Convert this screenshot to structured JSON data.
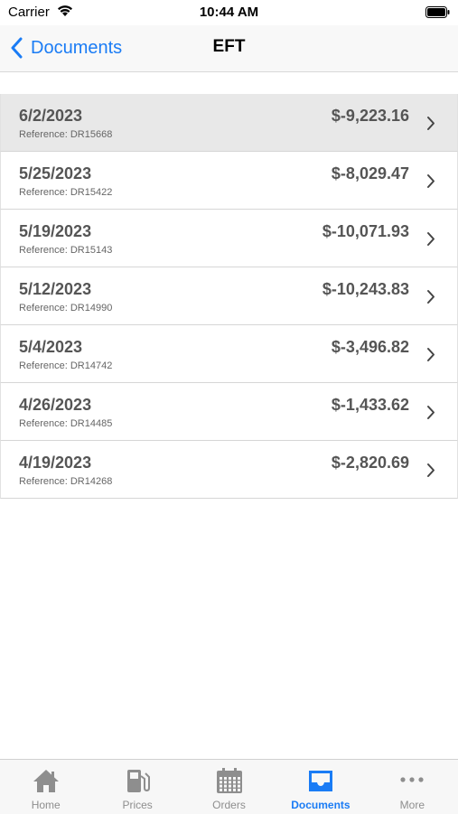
{
  "status_bar": {
    "carrier": "Carrier",
    "time": "10:44 AM"
  },
  "nav": {
    "back_label": "Documents",
    "title": "EFT"
  },
  "entries": [
    {
      "date": "6/2/2023",
      "reference": "Reference: DR15668",
      "amount": "$-9,223.16"
    },
    {
      "date": "5/25/2023",
      "reference": "Reference: DR15422",
      "amount": "$-8,029.47"
    },
    {
      "date": "5/19/2023",
      "reference": "Reference: DR15143",
      "amount": "$-10,071.93"
    },
    {
      "date": "5/12/2023",
      "reference": "Reference: DR14990",
      "amount": "$-10,243.83"
    },
    {
      "date": "5/4/2023",
      "reference": "Reference: DR14742",
      "amount": "$-3,496.82"
    },
    {
      "date": "4/26/2023",
      "reference": "Reference: DR14485",
      "amount": "$-1,433.62"
    },
    {
      "date": "4/19/2023",
      "reference": "Reference: DR14268",
      "amount": "$-2,820.69"
    }
  ],
  "tabs": [
    {
      "label": "Home",
      "icon": "home-icon",
      "active": false
    },
    {
      "label": "Prices",
      "icon": "fuel-pump-icon",
      "active": false
    },
    {
      "label": "Orders",
      "icon": "calendar-icon",
      "active": false
    },
    {
      "label": "Documents",
      "icon": "inbox-tray-icon",
      "active": true
    },
    {
      "label": "More",
      "icon": "more-dots-icon",
      "active": false
    }
  ],
  "colors": {
    "accent": "#1a7cf5",
    "inactive_tab": "#8e8e8e",
    "selected_row": "#e8e8e8",
    "text": "#555555"
  }
}
